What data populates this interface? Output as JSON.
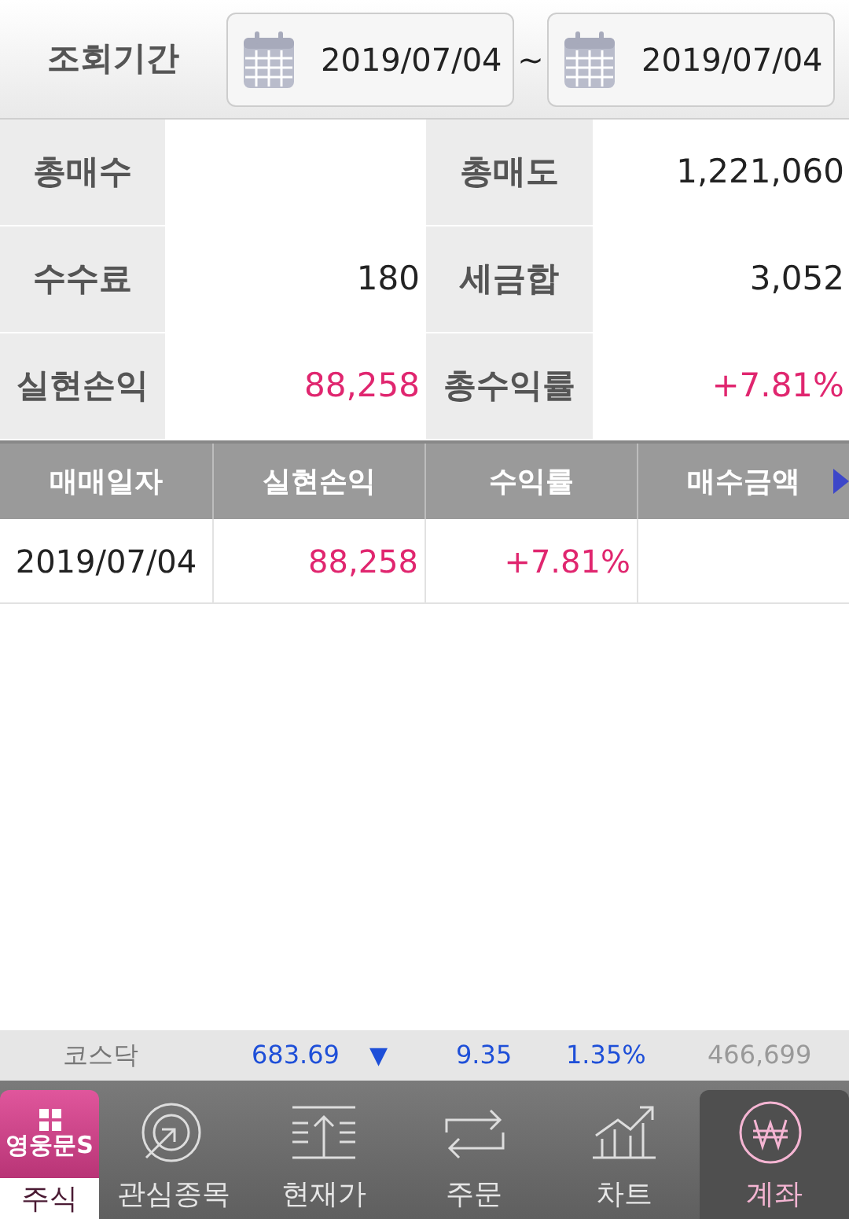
{
  "header": {
    "label": "조회기간",
    "start_date": "2019/07/04",
    "separator": "~",
    "end_date": "2019/07/04"
  },
  "summary": [
    {
      "label": "총매수"
    },
    {
      "label": "총매도",
      "value": "1,221,060",
      "kind": "plain"
    },
    {
      "label": "수수료",
      "value": "180",
      "kind": "plain"
    },
    {
      "label": "세금합",
      "value": "3,052",
      "kind": "plain"
    },
    {
      "label": "실현손익",
      "value": "88,258",
      "kind": "gain"
    },
    {
      "label": "총수익률",
      "value": "+7.81%",
      "kind": "gain"
    }
  ],
  "table": {
    "columns": [
      "매매일자",
      "실현손익",
      "수익률",
      "매수금액"
    ],
    "rows": [
      {
        "cells": [
          {
            "text": "2019/07/04",
            "kind": "plain"
          },
          {
            "text": "88,258",
            "kind": "gain"
          },
          {
            "text": "+7.81%",
            "kind": "gain"
          },
          {}
        ]
      }
    ]
  },
  "ticker": {
    "name": "코스닥",
    "value": "683.69",
    "arrow": "▼",
    "change": "9.35",
    "rate": "1.35%",
    "volume": "466,699"
  },
  "nav": [
    {
      "kind": "logo",
      "logo_text": "영웅문S",
      "label": "주식"
    },
    {
      "kind": "target",
      "label": "관심종목",
      "selected": false
    },
    {
      "kind": "price",
      "label": "현재가",
      "selected": false
    },
    {
      "kind": "order",
      "label": "주문",
      "selected": false
    },
    {
      "kind": "chart",
      "label": "차트",
      "selected": false
    },
    {
      "kind": "won",
      "label": "계좌",
      "selected": true
    }
  ]
}
